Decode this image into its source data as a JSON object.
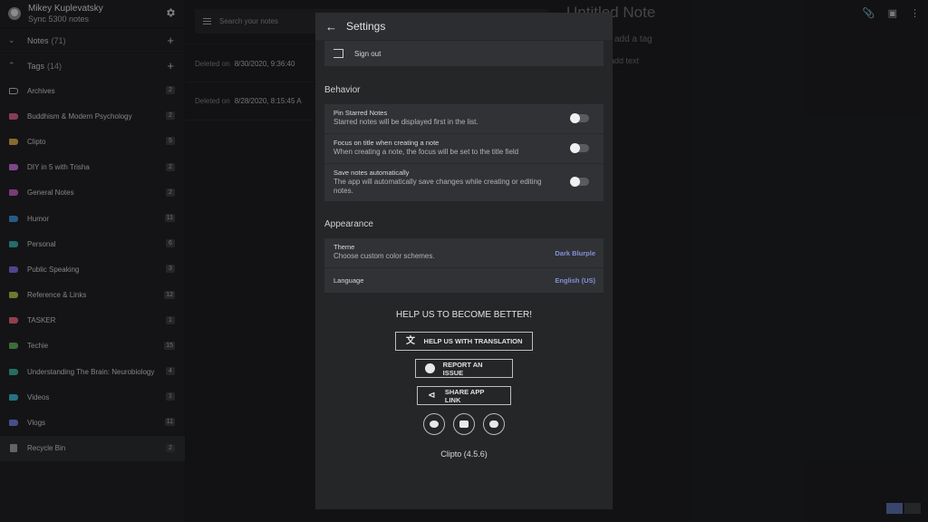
{
  "profile": {
    "name": "Mikey Kuplevatsky",
    "sync": "Sync 5300 notes"
  },
  "sections": {
    "notes": {
      "label": "Notes",
      "count": "(71)"
    },
    "tags": {
      "label": "Tags",
      "count": "(14)"
    }
  },
  "tags": [
    {
      "label": "Archives",
      "count": "2",
      "color": "outline"
    },
    {
      "label": "Buddhism & Modern Psychology",
      "count": "2",
      "color": "#d45a8b"
    },
    {
      "label": "Clipto",
      "count": "5",
      "color": "#d2a24a"
    },
    {
      "label": "DIY in 5 with Trisha",
      "count": "2",
      "color": "#c46ad4"
    },
    {
      "label": "General Notes",
      "count": "2",
      "color": "#b95db8"
    },
    {
      "label": "Humor",
      "count": "11",
      "color": "#3e8bd0"
    },
    {
      "label": "Personal",
      "count": "6",
      "color": "#37a6a8"
    },
    {
      "label": "Public Speaking",
      "count": "3",
      "color": "#7a6ad4"
    },
    {
      "label": "Reference & Links",
      "count": "12",
      "color": "#a8b84a"
    },
    {
      "label": "TASKER",
      "count": "1",
      "color": "#e0607a"
    },
    {
      "label": "Techie",
      "count": "15",
      "color": "#5aa85a"
    },
    {
      "label": "Understanding The Brain: Neurobiology",
      "count": "4",
      "color": "#3aa898"
    },
    {
      "label": "Videos",
      "count": "1",
      "color": "#3ab0c8"
    },
    {
      "label": "Vlogs",
      "count": "11",
      "color": "#6a7ad8"
    }
  ],
  "recycle": {
    "label": "Recycle Bin",
    "count": "2"
  },
  "search": {
    "placeholder": "Search your notes"
  },
  "notes_list": [
    {
      "prefix": "Deleted on",
      "date": "8/30/2020, 9:36:40"
    },
    {
      "prefix": "Deleted on",
      "date": "8/28/2020, 8:15:45 A"
    }
  ],
  "editor": {
    "title": "Untitled Note",
    "tag": "add a tag",
    "text": "add text"
  },
  "settings": {
    "title": "Settings",
    "signout": "Sign out",
    "behavior_title": "Behavior",
    "behavior": [
      {
        "name": "Pin Starred Notes",
        "desc": "Starred notes will be displayed first in the list."
      },
      {
        "name": "Focus on title when creating a note",
        "desc": "When creating a note, the focus will be set to the title field"
      },
      {
        "name": "Save notes automatically",
        "desc": "The app will automatically save changes while creating or editing notes."
      }
    ],
    "appearance_title": "Appearance",
    "theme": {
      "name": "Theme",
      "desc": "Choose custom color schemes.",
      "value": "Dark Blurple"
    },
    "language": {
      "name": "Language",
      "value": "English (US)"
    },
    "help_title": "HELP US TO BECOME BETTER!",
    "btn_translate": "HELP US WITH TRANSLATION",
    "btn_issue": "REPORT AN ISSUE",
    "btn_share": "SHARE APP LINK",
    "version": "Clipto (4.5.6)"
  }
}
